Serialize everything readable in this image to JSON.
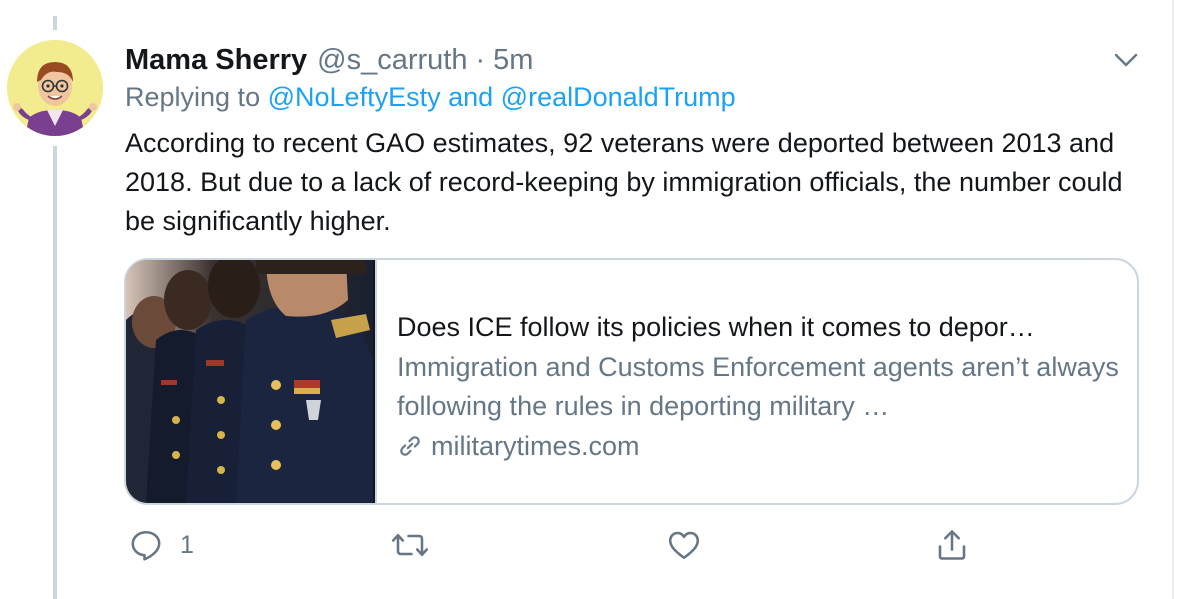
{
  "tweet": {
    "author_name": "Mama Sherry",
    "handle": "@s_carruth",
    "separator": "·",
    "time": "5m",
    "replying_prefix": "Replying to",
    "mentions": [
      "@NoLeftyEsty",
      "@realDonaldTrump"
    ],
    "mention_joiner": "and",
    "text": "According to recent GAO estimates, 92 veterans were deported between 2013 and 2018. But due to a lack of record-keeping by immigration officials, the number could be significantly higher."
  },
  "card": {
    "title": "Does ICE follow its policies when it comes to depor…",
    "description": "Immigration and Customs Enforcement agents aren’t always following the rules in deporting military …",
    "domain": "militarytimes.com",
    "image_subject": "soldiers in dress uniform"
  },
  "actions": {
    "reply_count": "1",
    "icons": [
      "reply-icon",
      "retweet-icon",
      "like-icon",
      "share-icon"
    ]
  },
  "colors": {
    "link": "#1da1f2",
    "secondary_text": "#657786",
    "border": "#ccd6dd",
    "avatar_bg": "#f3ec8f"
  }
}
